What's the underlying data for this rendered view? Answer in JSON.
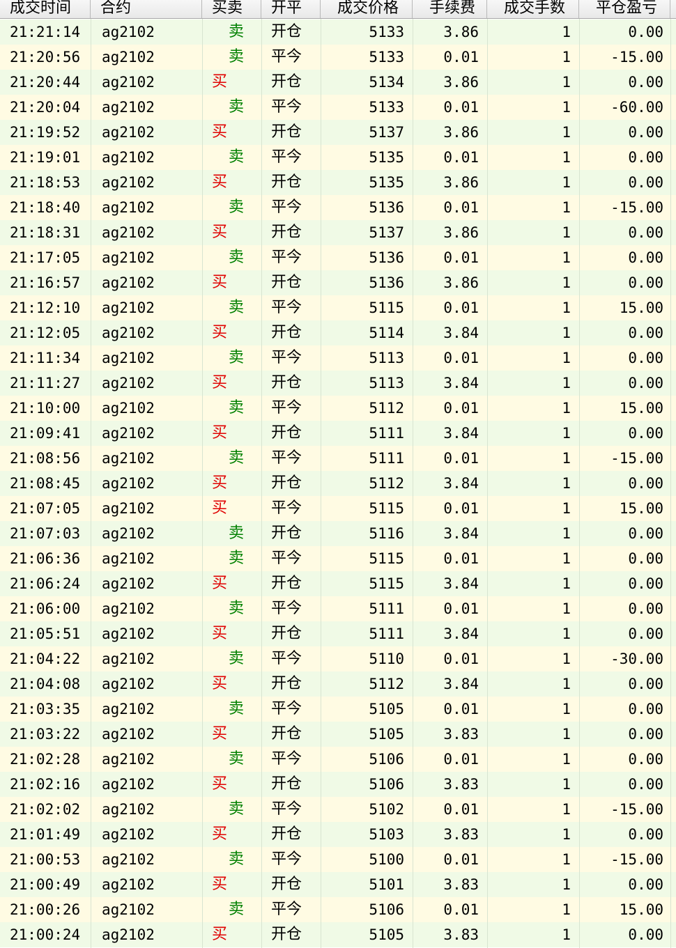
{
  "columns": [
    "成交时间",
    "合约",
    "买卖",
    "开平",
    "成交价格",
    "手续费",
    "成交手数",
    "平仓盈亏"
  ],
  "colors": {
    "buy": "#e00000",
    "sell": "#008000",
    "row_green": "#f0fae6",
    "row_yellow": "#fffbe3"
  },
  "rows": [
    {
      "time": "21:21:14",
      "inst": "ag2102",
      "dir": "卖",
      "side": "sell",
      "oc": "开仓",
      "price": "5133",
      "fee": "3.86",
      "qty": "1",
      "pnl": "0.00"
    },
    {
      "time": "21:20:56",
      "inst": "ag2102",
      "dir": "卖",
      "side": "sell",
      "oc": "平今",
      "price": "5133",
      "fee": "0.01",
      "qty": "1",
      "pnl": "-15.00"
    },
    {
      "time": "21:20:44",
      "inst": "ag2102",
      "dir": "买",
      "side": "buy",
      "oc": "开仓",
      "price": "5134",
      "fee": "3.86",
      "qty": "1",
      "pnl": "0.00"
    },
    {
      "time": "21:20:04",
      "inst": "ag2102",
      "dir": "卖",
      "side": "sell",
      "oc": "平今",
      "price": "5133",
      "fee": "0.01",
      "qty": "1",
      "pnl": "-60.00"
    },
    {
      "time": "21:19:52",
      "inst": "ag2102",
      "dir": "买",
      "side": "buy",
      "oc": "开仓",
      "price": "5137",
      "fee": "3.86",
      "qty": "1",
      "pnl": "0.00"
    },
    {
      "time": "21:19:01",
      "inst": "ag2102",
      "dir": "卖",
      "side": "sell",
      "oc": "平今",
      "price": "5135",
      "fee": "0.01",
      "qty": "1",
      "pnl": "0.00"
    },
    {
      "time": "21:18:53",
      "inst": "ag2102",
      "dir": "买",
      "side": "buy",
      "oc": "开仓",
      "price": "5135",
      "fee": "3.86",
      "qty": "1",
      "pnl": "0.00"
    },
    {
      "time": "21:18:40",
      "inst": "ag2102",
      "dir": "卖",
      "side": "sell",
      "oc": "平今",
      "price": "5136",
      "fee": "0.01",
      "qty": "1",
      "pnl": "-15.00"
    },
    {
      "time": "21:18:31",
      "inst": "ag2102",
      "dir": "买",
      "side": "buy",
      "oc": "开仓",
      "price": "5137",
      "fee": "3.86",
      "qty": "1",
      "pnl": "0.00"
    },
    {
      "time": "21:17:05",
      "inst": "ag2102",
      "dir": "卖",
      "side": "sell",
      "oc": "平今",
      "price": "5136",
      "fee": "0.01",
      "qty": "1",
      "pnl": "0.00"
    },
    {
      "time": "21:16:57",
      "inst": "ag2102",
      "dir": "买",
      "side": "buy",
      "oc": "开仓",
      "price": "5136",
      "fee": "3.86",
      "qty": "1",
      "pnl": "0.00"
    },
    {
      "time": "21:12:10",
      "inst": "ag2102",
      "dir": "卖",
      "side": "sell",
      "oc": "平今",
      "price": "5115",
      "fee": "0.01",
      "qty": "1",
      "pnl": "15.00"
    },
    {
      "time": "21:12:05",
      "inst": "ag2102",
      "dir": "买",
      "side": "buy",
      "oc": "开仓",
      "price": "5114",
      "fee": "3.84",
      "qty": "1",
      "pnl": "0.00"
    },
    {
      "time": "21:11:34",
      "inst": "ag2102",
      "dir": "卖",
      "side": "sell",
      "oc": "平今",
      "price": "5113",
      "fee": "0.01",
      "qty": "1",
      "pnl": "0.00"
    },
    {
      "time": "21:11:27",
      "inst": "ag2102",
      "dir": "买",
      "side": "buy",
      "oc": "开仓",
      "price": "5113",
      "fee": "3.84",
      "qty": "1",
      "pnl": "0.00"
    },
    {
      "time": "21:10:00",
      "inst": "ag2102",
      "dir": "卖",
      "side": "sell",
      "oc": "平今",
      "price": "5112",
      "fee": "0.01",
      "qty": "1",
      "pnl": "15.00"
    },
    {
      "time": "21:09:41",
      "inst": "ag2102",
      "dir": "买",
      "side": "buy",
      "oc": "开仓",
      "price": "5111",
      "fee": "3.84",
      "qty": "1",
      "pnl": "0.00"
    },
    {
      "time": "21:08:56",
      "inst": "ag2102",
      "dir": "卖",
      "side": "sell",
      "oc": "平今",
      "price": "5111",
      "fee": "0.01",
      "qty": "1",
      "pnl": "-15.00"
    },
    {
      "time": "21:08:45",
      "inst": "ag2102",
      "dir": "买",
      "side": "buy",
      "oc": "开仓",
      "price": "5112",
      "fee": "3.84",
      "qty": "1",
      "pnl": "0.00"
    },
    {
      "time": "21:07:05",
      "inst": "ag2102",
      "dir": "买",
      "side": "buy",
      "oc": "平今",
      "price": "5115",
      "fee": "0.01",
      "qty": "1",
      "pnl": "15.00"
    },
    {
      "time": "21:07:03",
      "inst": "ag2102",
      "dir": "卖",
      "side": "sell",
      "oc": "开仓",
      "price": "5116",
      "fee": "3.84",
      "qty": "1",
      "pnl": "0.00"
    },
    {
      "time": "21:06:36",
      "inst": "ag2102",
      "dir": "卖",
      "side": "sell",
      "oc": "平今",
      "price": "5115",
      "fee": "0.01",
      "qty": "1",
      "pnl": "0.00"
    },
    {
      "time": "21:06:24",
      "inst": "ag2102",
      "dir": "买",
      "side": "buy",
      "oc": "开仓",
      "price": "5115",
      "fee": "3.84",
      "qty": "1",
      "pnl": "0.00"
    },
    {
      "time": "21:06:00",
      "inst": "ag2102",
      "dir": "卖",
      "side": "sell",
      "oc": "平今",
      "price": "5111",
      "fee": "0.01",
      "qty": "1",
      "pnl": "0.00"
    },
    {
      "time": "21:05:51",
      "inst": "ag2102",
      "dir": "买",
      "side": "buy",
      "oc": "开仓",
      "price": "5111",
      "fee": "3.84",
      "qty": "1",
      "pnl": "0.00"
    },
    {
      "time": "21:04:22",
      "inst": "ag2102",
      "dir": "卖",
      "side": "sell",
      "oc": "平今",
      "price": "5110",
      "fee": "0.01",
      "qty": "1",
      "pnl": "-30.00"
    },
    {
      "time": "21:04:08",
      "inst": "ag2102",
      "dir": "买",
      "side": "buy",
      "oc": "开仓",
      "price": "5112",
      "fee": "3.84",
      "qty": "1",
      "pnl": "0.00"
    },
    {
      "time": "21:03:35",
      "inst": "ag2102",
      "dir": "卖",
      "side": "sell",
      "oc": "平今",
      "price": "5105",
      "fee": "0.01",
      "qty": "1",
      "pnl": "0.00"
    },
    {
      "time": "21:03:22",
      "inst": "ag2102",
      "dir": "买",
      "side": "buy",
      "oc": "开仓",
      "price": "5105",
      "fee": "3.83",
      "qty": "1",
      "pnl": "0.00"
    },
    {
      "time": "21:02:28",
      "inst": "ag2102",
      "dir": "卖",
      "side": "sell",
      "oc": "平今",
      "price": "5106",
      "fee": "0.01",
      "qty": "1",
      "pnl": "0.00"
    },
    {
      "time": "21:02:16",
      "inst": "ag2102",
      "dir": "买",
      "side": "buy",
      "oc": "开仓",
      "price": "5106",
      "fee": "3.83",
      "qty": "1",
      "pnl": "0.00"
    },
    {
      "time": "21:02:02",
      "inst": "ag2102",
      "dir": "卖",
      "side": "sell",
      "oc": "平今",
      "price": "5102",
      "fee": "0.01",
      "qty": "1",
      "pnl": "-15.00"
    },
    {
      "time": "21:01:49",
      "inst": "ag2102",
      "dir": "买",
      "side": "buy",
      "oc": "开仓",
      "price": "5103",
      "fee": "3.83",
      "qty": "1",
      "pnl": "0.00"
    },
    {
      "time": "21:00:53",
      "inst": "ag2102",
      "dir": "卖",
      "side": "sell",
      "oc": "平今",
      "price": "5100",
      "fee": "0.01",
      "qty": "1",
      "pnl": "-15.00"
    },
    {
      "time": "21:00:49",
      "inst": "ag2102",
      "dir": "买",
      "side": "buy",
      "oc": "开仓",
      "price": "5101",
      "fee": "3.83",
      "qty": "1",
      "pnl": "0.00"
    },
    {
      "time": "21:00:26",
      "inst": "ag2102",
      "dir": "卖",
      "side": "sell",
      "oc": "平今",
      "price": "5106",
      "fee": "0.01",
      "qty": "1",
      "pnl": "15.00"
    },
    {
      "time": "21:00:24",
      "inst": "ag2102",
      "dir": "买",
      "side": "buy",
      "oc": "开仓",
      "price": "5105",
      "fee": "3.83",
      "qty": "1",
      "pnl": "0.00"
    }
  ]
}
